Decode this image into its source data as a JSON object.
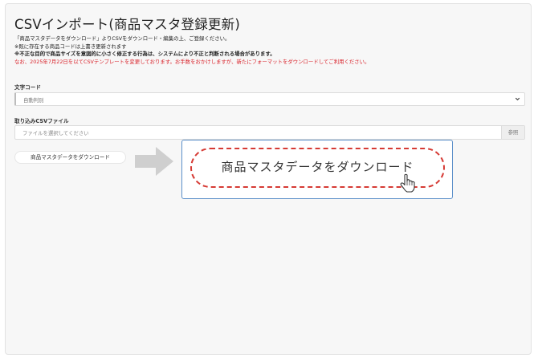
{
  "page": {
    "title": "CSVインポート(商品マスタ登録更新)"
  },
  "notes": {
    "line1": "「商品マスタデータをダウンロード」よりCSVをダウンロード・編集の上、ご登録ください。",
    "line2": "※既に存在する商品コードは上書き更新されます",
    "line3": "※不正な目的で商品サイズを意図的に小さく修正する行為は、システムにより不正と判断される場合があります。",
    "line4": "なお、2025年7月22日を以てCSVテンプレートを変更しております。お手数をおかけしますが、新たにフォーマットをダウンロードしてご利用ください。"
  },
  "encoding": {
    "label": "文字コード",
    "selected": "自動判別",
    "icon": "chevron-down-icon"
  },
  "file": {
    "label": "取り込みCSVファイル",
    "placeholder": "ファイルを選択してください",
    "browse_label": "参照"
  },
  "download": {
    "button_label": "商品マスタデータをダウンロード",
    "callout_label": "商品マスタデータをダウンロード",
    "arrow_icon": "arrow-right-icon",
    "cursor_icon": "hand-pointer-icon"
  },
  "colors": {
    "warning_red": "#d9232b",
    "callout_border": "#5b8fc9",
    "highlight_dash": "#d63a34"
  }
}
